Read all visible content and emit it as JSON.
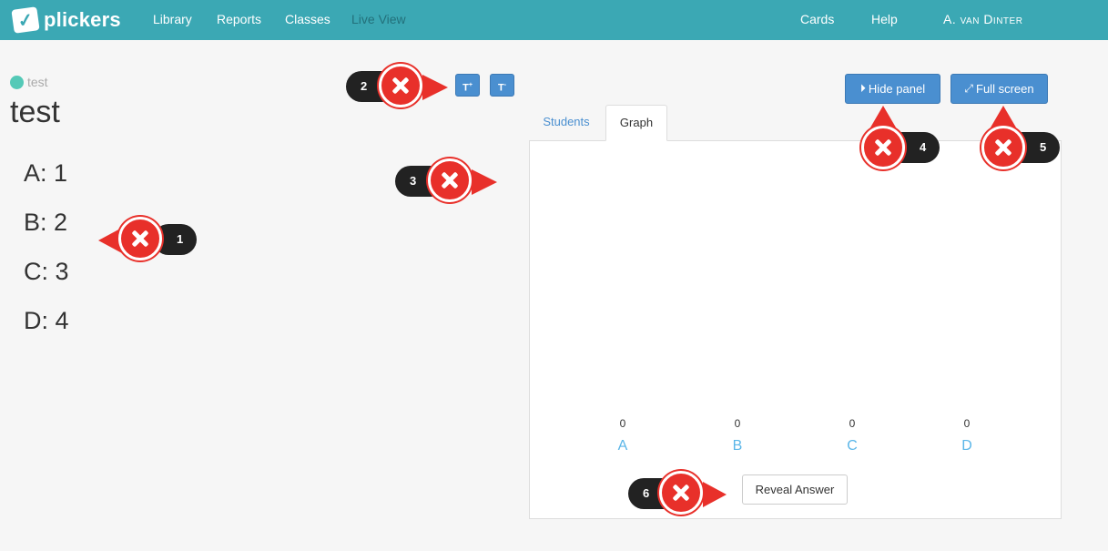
{
  "nav": {
    "brand": "plickers",
    "links": {
      "library": "Library",
      "reports": "Reports",
      "classes": "Classes",
      "live_view": "Live View",
      "cards": "Cards",
      "help": "Help",
      "user": "A. van Dinter"
    }
  },
  "question": {
    "status_label": "test",
    "title": "test",
    "answers": [
      "A: 1",
      "B: 2",
      "C: 3",
      "D: 4"
    ]
  },
  "font_controls": {
    "increase": "T",
    "decrease": "T"
  },
  "panel_controls": {
    "hide_panel": "Hide panel",
    "full_screen": "Full screen"
  },
  "tabs": {
    "students": "Students",
    "graph": "Graph"
  },
  "chart_data": {
    "type": "bar",
    "categories": [
      "A",
      "B",
      "C",
      "D"
    ],
    "values": [
      0,
      0,
      0,
      0
    ]
  },
  "reveal_answer": "Reveal Answer",
  "callouts": [
    "1",
    "2",
    "3",
    "4",
    "5",
    "6"
  ],
  "colors": {
    "navbar": "#3ba8b4",
    "primary_button": "#4a8fd0",
    "status_dot": "#54c9b7",
    "graph_label": "#5bb6e8",
    "callout_marker": "#e8302a"
  }
}
